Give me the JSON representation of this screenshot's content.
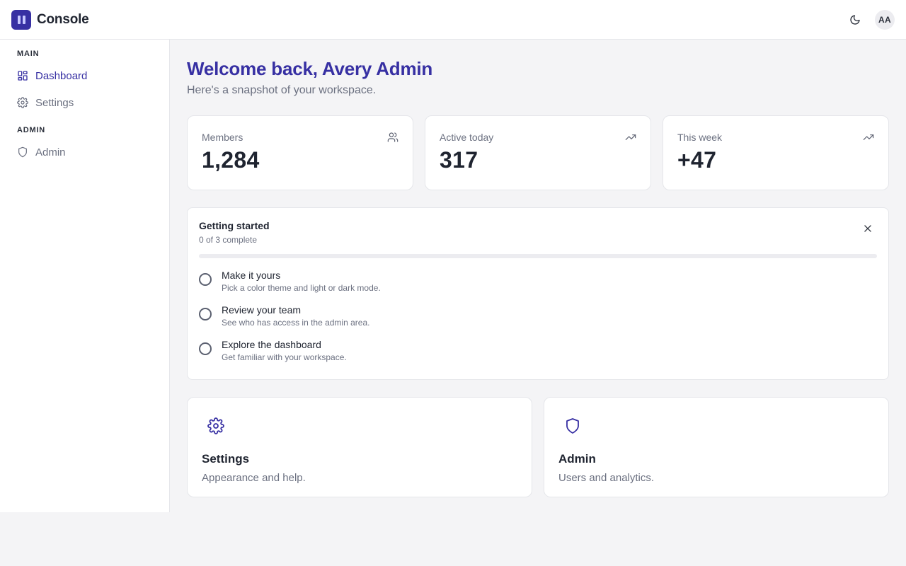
{
  "app": {
    "name": "Console"
  },
  "header": {
    "avatar_initials": "AA",
    "theme_icon": "moon-icon"
  },
  "sidebar": {
    "sections": [
      {
        "title": "MAIN",
        "items": [
          {
            "label": "Dashboard",
            "icon": "dashboard-icon",
            "active": true
          },
          {
            "label": "Settings",
            "icon": "gear-icon",
            "active": false
          }
        ]
      },
      {
        "title": "ADMIN",
        "items": [
          {
            "label": "Admin",
            "icon": "shield-icon",
            "active": false
          }
        ]
      }
    ]
  },
  "main": {
    "welcome": "Welcome back, Avery Admin",
    "subtitle": "Here's a snapshot of your workspace.",
    "stats": [
      {
        "label": "Members",
        "value": "1,284",
        "icon": "users-icon"
      },
      {
        "label": "Active today",
        "value": "317",
        "icon": "trending-up-icon"
      },
      {
        "label": "This week",
        "value": "+47",
        "icon": "trending-up-icon"
      }
    ],
    "getting_started": {
      "title": "Getting started",
      "progress_text": "0 of 3 complete",
      "progress_fraction": 0,
      "tasks": [
        {
          "title": "Make it yours",
          "description": "Pick a color theme and light or dark mode."
        },
        {
          "title": "Review your team",
          "description": "See who has access in the admin area."
        },
        {
          "title": "Explore the dashboard",
          "description": "Get familiar with your workspace."
        }
      ]
    },
    "cards": [
      {
        "title": "Settings",
        "description": "Appearance and help.",
        "icon": "gear-icon"
      },
      {
        "title": "Admin",
        "description": "Users and analytics.",
        "icon": "shield-icon"
      }
    ]
  },
  "colors": {
    "accent": "#3730a3",
    "background": "#f4f4f6",
    "surface": "#ffffff",
    "muted_text": "#6b7080"
  }
}
